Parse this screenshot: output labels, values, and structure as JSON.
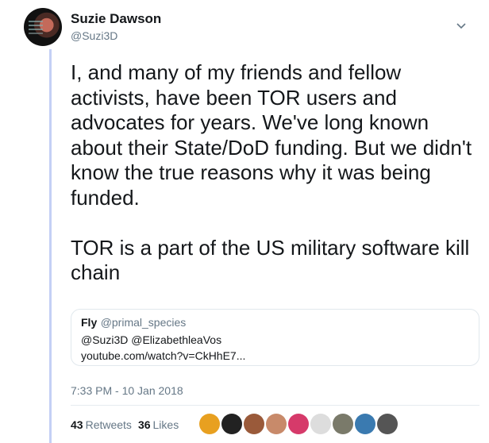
{
  "author": {
    "name": "Suzie Dawson",
    "handle": "@Suzi3D",
    "avatar_icon": "profile-photo"
  },
  "tweet": {
    "text": "I, and many of my friends and fellow activists, have been TOR users and advocates for years. We've long known about their State/DoD funding. But we didn't know the true reasons why it was being funded.\n\nTOR is a part of the US military software kill chain"
  },
  "quote": {
    "name": "Fly",
    "handle": "@primal_species",
    "mentions": "@Suzi3D @ElizabethleaVos",
    "url": "youtube.com/watch?v=CkHhE7..."
  },
  "meta": {
    "timestamp": "7:33 PM - 10 Jan 2018"
  },
  "stats": {
    "retweets_count": "43",
    "retweets_label": "Retweets",
    "likes_count": "36",
    "likes_label": "Likes"
  },
  "likers": [
    {
      "color": "#e8a020"
    },
    {
      "color": "#222222"
    },
    {
      "color": "#9a5a3a"
    },
    {
      "color": "#c88a6a"
    },
    {
      "color": "#d63a6a"
    },
    {
      "color": "#dddddd"
    },
    {
      "color": "#7a7a6a"
    },
    {
      "color": "#3a7ab0"
    },
    {
      "color": "#555555"
    }
  ],
  "colors": {
    "thread_line": "#c4d0f5",
    "secondary_text": "#657786"
  }
}
